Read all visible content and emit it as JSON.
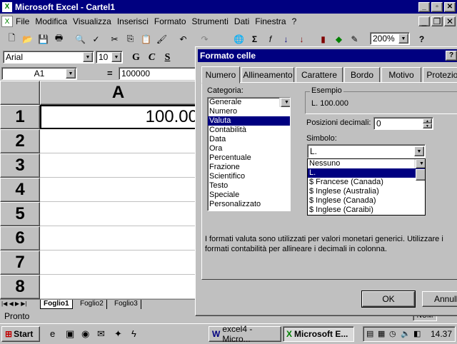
{
  "window": {
    "title": "Microsoft Excel - Cartel1"
  },
  "menu": [
    "File",
    "Modifica",
    "Visualizza",
    "Inserisci",
    "Formato",
    "Strumenti",
    "Dati",
    "Finestra",
    "?"
  ],
  "toolbar": {
    "zoom": "200%"
  },
  "format_bar": {
    "font": "Arial",
    "size": "10",
    "bold": "G",
    "italic": "C",
    "underline": "S"
  },
  "formula_bar": {
    "cell_ref": "A1",
    "equals": "=",
    "value": "100000"
  },
  "sheet": {
    "col_header": "A",
    "rows": [
      "1",
      "2",
      "3",
      "4",
      "5",
      "6",
      "7",
      "8"
    ],
    "a1_value": "100.00",
    "tabs": [
      "Foglio1",
      "Foglio2",
      "Foglio3"
    ]
  },
  "status": {
    "text": "Pronto",
    "num": "NUM"
  },
  "dialog": {
    "title": "Formato celle",
    "tabs": [
      "Numero",
      "Allineamento",
      "Carattere",
      "Bordo",
      "Motivo",
      "Protezione"
    ],
    "category_label": "Categoria:",
    "categories": [
      "Generale",
      "Numero",
      "Valuta",
      "Contabilità",
      "Data",
      "Ora",
      "Percentuale",
      "Frazione",
      "Scientifico",
      "Testo",
      "Speciale",
      "Personalizzato"
    ],
    "selected_category": "Valuta",
    "sample_label": "Esempio",
    "sample_value": "L. 100.000",
    "decimals_label": "Posizioni decimali:",
    "decimals_value": "0",
    "symbol_label": "Simbolo:",
    "symbol_value": "L.",
    "symbol_options": [
      "Nessuno",
      "L.",
      "$ Francese (Canada)",
      "$ Inglese (Australia)",
      "$ Inglese (Canada)",
      "$ Inglese (Caraibi)"
    ],
    "description": "I formati valuta sono utilizzati per valori  monetari generici. Utilizzare i formati contabilità per allineare i decimali in colonna.",
    "ok": "OK",
    "cancel": "Annulla"
  },
  "taskbar": {
    "start": "Start",
    "items": [
      "excel4 - Micro...",
      "Microsoft E..."
    ],
    "clock": "14.37"
  }
}
